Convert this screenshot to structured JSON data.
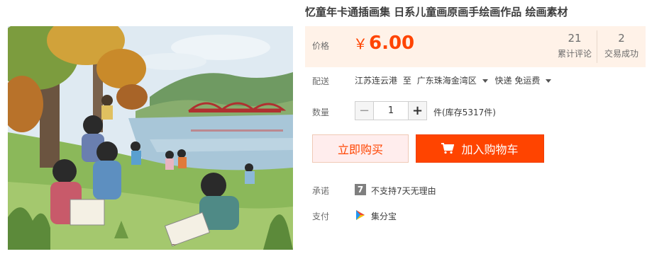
{
  "product": {
    "title": "忆童年卡通插画集 日系儿童画原画手绘画作品 绘画素材"
  },
  "price": {
    "label": "价格",
    "currency": "￥",
    "amount": "6.00"
  },
  "stats": {
    "reviews_count": "21",
    "reviews_label": "累计评论",
    "trades_count": "2",
    "trades_label": "交易成功"
  },
  "shipping": {
    "label": "配送",
    "origin": "江苏连云港",
    "to": "至",
    "destination": "广东珠海金湾区",
    "method": "快递 免运费"
  },
  "quantity": {
    "label": "数量",
    "value": "1",
    "unit_stock": "件(库存5317件)"
  },
  "buttons": {
    "buy_now": "立即购买",
    "add_to_cart": "加入购物车"
  },
  "promise": {
    "label": "承诺",
    "icon_text": "7",
    "text": "不支持7天无理由"
  },
  "payment": {
    "label": "支付",
    "text": "集分宝"
  },
  "colors": {
    "accent": "#ff4400",
    "price_bg": "#fff2e8",
    "buy_bg": "#ffeded"
  },
  "icons": {
    "cart": "cart-icon",
    "promise": "seven-day-icon",
    "payment": "jifenbao-icon"
  }
}
